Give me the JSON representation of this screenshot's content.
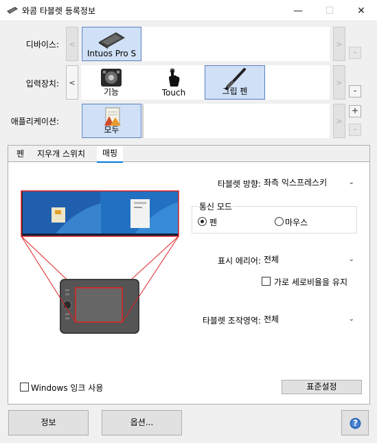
{
  "window": {
    "title": "와콤 타블렛 등록정보",
    "minimize": "—",
    "maximize": "☐",
    "close": "✕"
  },
  "devices": {
    "label": "디바이스:",
    "left": "<",
    "right": ">",
    "remove": "-",
    "items": [
      {
        "label": "Intuos Pro S",
        "icon": "tablet-icon",
        "selected": true
      }
    ]
  },
  "tools": {
    "label": "입력장치:",
    "left": "<",
    "right": ">",
    "remove": "-",
    "items": [
      {
        "label": "기능",
        "icon": "functions-icon",
        "selected": false
      },
      {
        "label": "Touch",
        "icon": "touch-hand-icon",
        "selected": false
      },
      {
        "label": "그립 펜",
        "icon": "grip-pen-icon",
        "selected": true
      }
    ]
  },
  "applications": {
    "label": "애플리케이션:",
    "right": ">",
    "add": "+",
    "remove": "-",
    "items": [
      {
        "label": "모두",
        "icon": "all-apps-icon",
        "selected": true
      }
    ]
  },
  "tabs": [
    {
      "label": "펜",
      "selected": false
    },
    {
      "label": "지우개 스위치",
      "selected": false
    },
    {
      "label": "매핑",
      "selected": true
    }
  ],
  "mapping": {
    "orientation_label": "타블렛 방향:",
    "orientation_value": "좌측 익스프레스키",
    "mode_label": "통신 모드",
    "mode_pen": "펜",
    "mode_mouse": "마우스",
    "mode_selected": "pen",
    "screen_area_label": "표시 에리어:",
    "screen_area_value": "전체",
    "force_proportions": "가로 세로비율을 유지",
    "force_proportions_checked": false,
    "tablet_area_label": "타블렛 조작영역:",
    "tablet_area_value": "전체",
    "windows_ink": "Windows 잉크 사용",
    "windows_ink_checked": false,
    "default_button": "표준설정"
  },
  "footer": {
    "about": "정보",
    "options": "옵션...",
    "help": "?"
  },
  "colors": {
    "accent": "#0078d7",
    "selection": "#cfe0f7",
    "map_lines": "#e02020",
    "help_blue": "#2b68b5"
  }
}
